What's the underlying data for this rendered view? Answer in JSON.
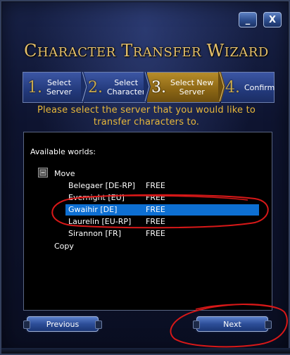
{
  "window": {
    "title": "Character Transfer Wizard",
    "minimize_label": "_",
    "close_label": "X"
  },
  "steps": [
    {
      "number": "1.",
      "label_line1": "Select",
      "label_line2": "Server",
      "state": "normal"
    },
    {
      "number": "2.",
      "label_line1": "Select",
      "label_line2": "Character",
      "state": "normal"
    },
    {
      "number": "3.",
      "label_line1": "Select New",
      "label_line2": "Server",
      "state": "active"
    },
    {
      "number": "4.",
      "label_line1": "Confirm",
      "label_line2": "",
      "state": "normal"
    }
  ],
  "instructions": {
    "line1": "Please select the server that you would like to",
    "line2": "transfer characters to."
  },
  "worlds": {
    "heading": "Available worlds:",
    "groups": [
      {
        "label": "Move",
        "expanded": true
      },
      {
        "label": "Copy",
        "expanded": false
      }
    ],
    "servers": [
      {
        "name": "Belegaer [DE-RP]",
        "status": "FREE",
        "selected": false
      },
      {
        "name": "Evernight [EU]",
        "status": "FREE",
        "selected": false
      },
      {
        "name": "Gwaihir [DE]",
        "status": "FREE",
        "selected": true
      },
      {
        "name": "Laurelin [EU-RP]",
        "status": "FREE",
        "selected": false
      },
      {
        "name": "Sirannon [FR]",
        "status": "FREE",
        "selected": false
      }
    ]
  },
  "buttons": {
    "previous": "Previous",
    "next": "Next"
  },
  "colors": {
    "title_gold": "#e6c16a",
    "instruction_gold": "#e8b83a",
    "step_blue": "#2a4488",
    "step_active_gold": "#9a7318",
    "selection_blue": "#0d6fd2",
    "annotation_red": "#d81818"
  },
  "icons": {
    "minimize": "minimize-icon",
    "close": "close-icon",
    "tree": "tree-expand-icon"
  }
}
